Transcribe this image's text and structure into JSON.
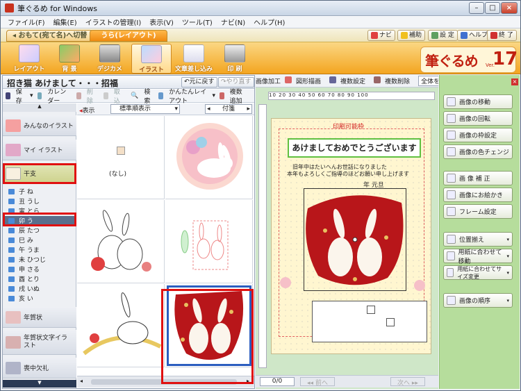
{
  "window": {
    "title": "筆ぐるめ for Windows"
  },
  "menu": [
    "ファイル(F)",
    "編集(E)",
    "イラストの管理(I)",
    "表示(V)",
    "ツール(T)",
    "ナビ(N)",
    "ヘルプ(H)"
  ],
  "modes": {
    "omote": "おもて(宛て名)へ切替",
    "ura": "うら(レイアウト)"
  },
  "topright": {
    "navi": "ナビ",
    "hojo": "補助",
    "settei": "設 定",
    "help": "ヘルプ",
    "exit": "終 了"
  },
  "ribbon": {
    "layout": "レイアウト",
    "haikei": "背 景",
    "digicame": "デジカメ",
    "illust": "イラスト",
    "bunsho": "文章差し込み",
    "print": "印 刷"
  },
  "logo": {
    "text": "筆ぐるめ",
    "version": "17",
    "ver_label": "Ver."
  },
  "left": {
    "header_title": "招き猫 あけまして・・・招福",
    "undo": "元に戻す",
    "redo": "やり直す",
    "tools": {
      "save": "保存",
      "calendar": "カレンダー",
      "delete": "削除",
      "take": "取込",
      "search": "検 索",
      "easy_layout": "かんたんレイアウト",
      "multi_add": "複数追加"
    },
    "categories": {
      "minna": "みんなのイラスト",
      "my": "マイ イラスト",
      "eto": "干支",
      "nengajo": "年賀状",
      "nengajo_moji": "年賀状文字イラスト",
      "mochu": "喪中欠礼"
    },
    "eto_items": [
      "子 ね",
      "丑 うし",
      "寅 とら",
      "卯 う",
      "辰 たつ",
      "巳 み",
      "午 うま",
      "未 ひつじ",
      "申 さる",
      "酉 とり",
      "戌 いぬ",
      "亥 い"
    ],
    "view": {
      "label": "表示",
      "sort": "標準順表示",
      "tag": "付箋"
    },
    "nashi": "(なし)"
  },
  "mid": {
    "tools": [
      "画像加工",
      "図形描画",
      "複数設定",
      "複数削除",
      "全体を表示"
    ],
    "ruler": "10 20 30 40 50 60 70 80 90 100",
    "card": {
      "print_area": "印刷可能枠",
      "greeting": "あけましておめでとうございます",
      "body_line1": "旧年中はたいへんお世話になりました",
      "body_line2": "本年もよろしくご指導のほどお願い申し上げます",
      "date": "年 元旦"
    },
    "page": "0/0",
    "prev": "前へ",
    "next": "次へ"
  },
  "right": {
    "buttons": [
      "画像の移動",
      "画像の回転",
      "画像の枠設定",
      "画像の色チェンジ",
      "画 像 補 正",
      "画像にお絵かき",
      "フレーム設定",
      "位置揃え",
      "用紙に合わせて移動",
      "用紙に合わせてサイズ変更",
      "画像の順序"
    ]
  },
  "colors": {
    "accent": "#f3a520",
    "select_red": "#e01010",
    "usagi_red": "#b8161a",
    "panel_green": "#b6dd9c"
  }
}
